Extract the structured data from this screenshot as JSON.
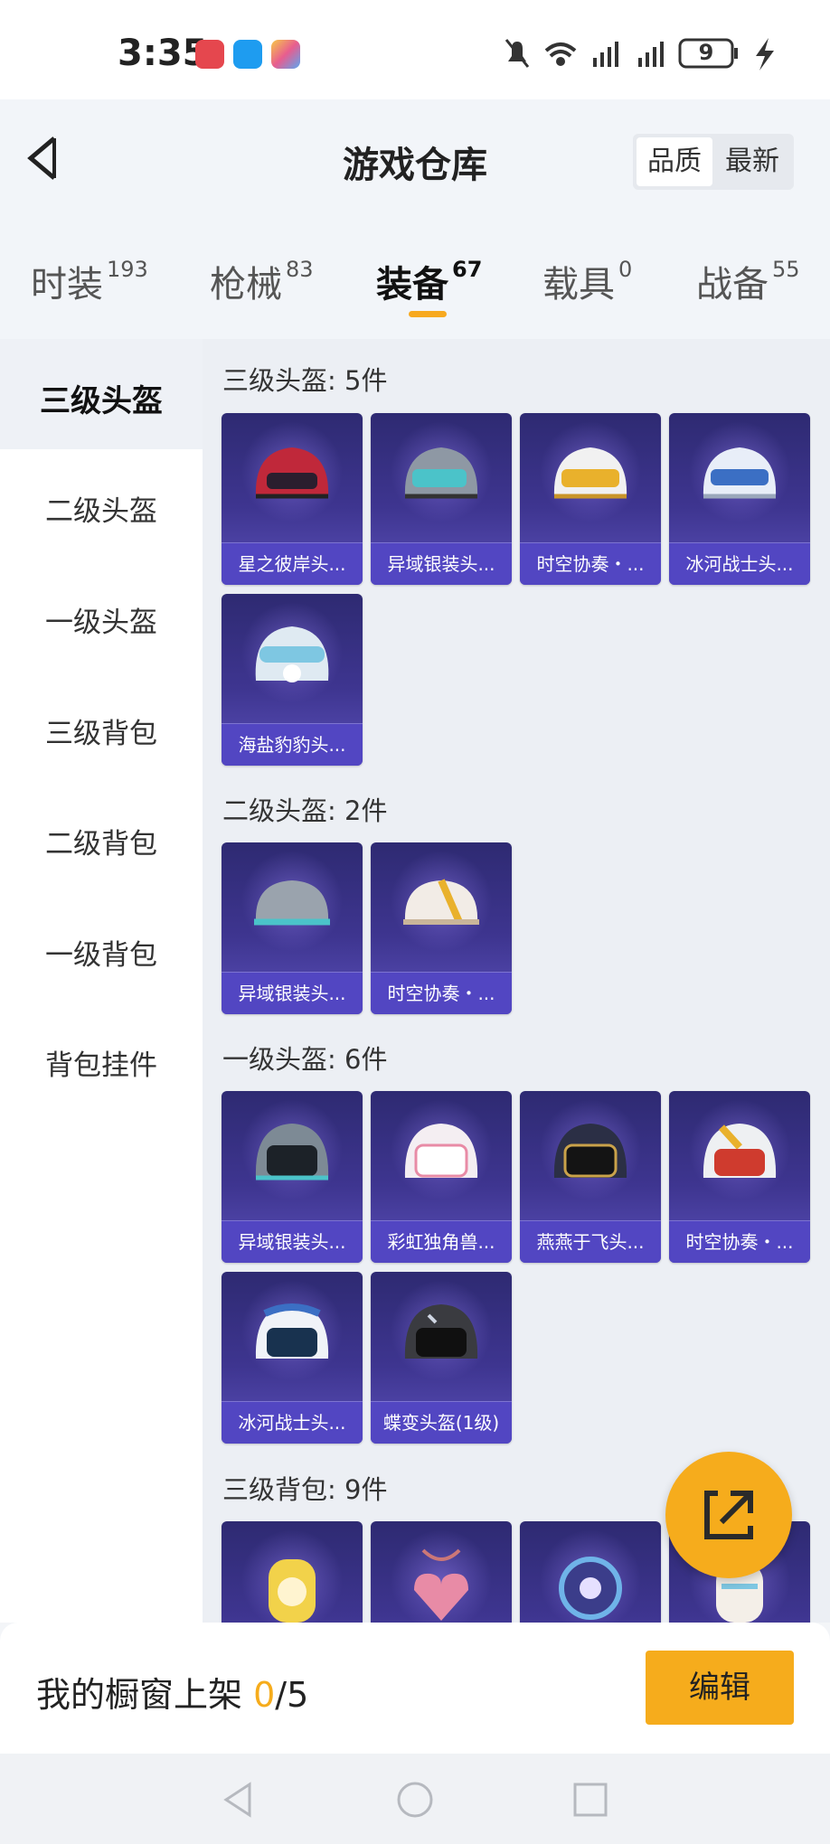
{
  "status_bar": {
    "time": "3:35",
    "battery": "9"
  },
  "header": {
    "title": "游戏仓库",
    "sort_options": [
      "品质",
      "最新"
    ],
    "sort_selected": "品质"
  },
  "tabs": [
    {
      "label": "时装",
      "count": "193"
    },
    {
      "label": "枪械",
      "count": "83"
    },
    {
      "label": "装备",
      "count": "67"
    },
    {
      "label": "载具",
      "count": "0"
    },
    {
      "label": "战备",
      "count": "55"
    }
  ],
  "active_tab": "装备",
  "sidebar": {
    "items": [
      "三级头盔",
      "二级头盔",
      "一级头盔",
      "三级背包",
      "二级背包",
      "一级背包",
      "背包挂件"
    ],
    "active": "三级头盔"
  },
  "sections": [
    {
      "title": "三级头盔: 5件",
      "items": [
        {
          "name": "星之彼岸头...",
          "color": "#c0283a"
        },
        {
          "name": "异域银装头...",
          "color": "#4bc3c9"
        },
        {
          "name": "时空协奏・...",
          "color": "#e9b12c"
        },
        {
          "name": "冰河战士头...",
          "color": "#e8eef8"
        },
        {
          "name": "海盐豹豹头...",
          "color": "#dfeaf2"
        }
      ]
    },
    {
      "title": "二级头盔: 2件",
      "items": [
        {
          "name": "异域银装头...",
          "color": "#9aa3ad"
        },
        {
          "name": "时空协奏・...",
          "color": "#f2ece6"
        }
      ]
    },
    {
      "title": "一级头盔: 6件",
      "items": [
        {
          "name": "异域银装头...",
          "color": "#7d8a95"
        },
        {
          "name": "彩虹独角兽...",
          "color": "#f4eef2"
        },
        {
          "name": "燕燕于飞头...",
          "color": "#2b2f45"
        },
        {
          "name": "时空协奏・...",
          "color": "#eef0f2"
        },
        {
          "name": "冰河战士头...",
          "color": "#f0f3f8"
        },
        {
          "name": "蝶变头盔(1级)",
          "color": "#3a3b40"
        }
      ]
    },
    {
      "title": "三级背包: 9件",
      "items": [
        {
          "name": "",
          "color": "#f2d24a"
        },
        {
          "name": "",
          "color": "#e88ba6"
        },
        {
          "name": "",
          "color": "#6fb3e8"
        },
        {
          "name": "",
          "color": "#f4efe8"
        }
      ]
    }
  ],
  "bottom": {
    "shelf_label": "我的橱窗上架 ",
    "shelf_count": "0",
    "shelf_total": "/5",
    "edit_label": "编辑"
  },
  "colors": {
    "accent": "#f6ac1c",
    "card_label": "#5246c2"
  },
  "icons": [
    "back-arrow-icon",
    "share-export-icon",
    "nav-back-icon",
    "nav-home-icon",
    "nav-recents-icon"
  ]
}
